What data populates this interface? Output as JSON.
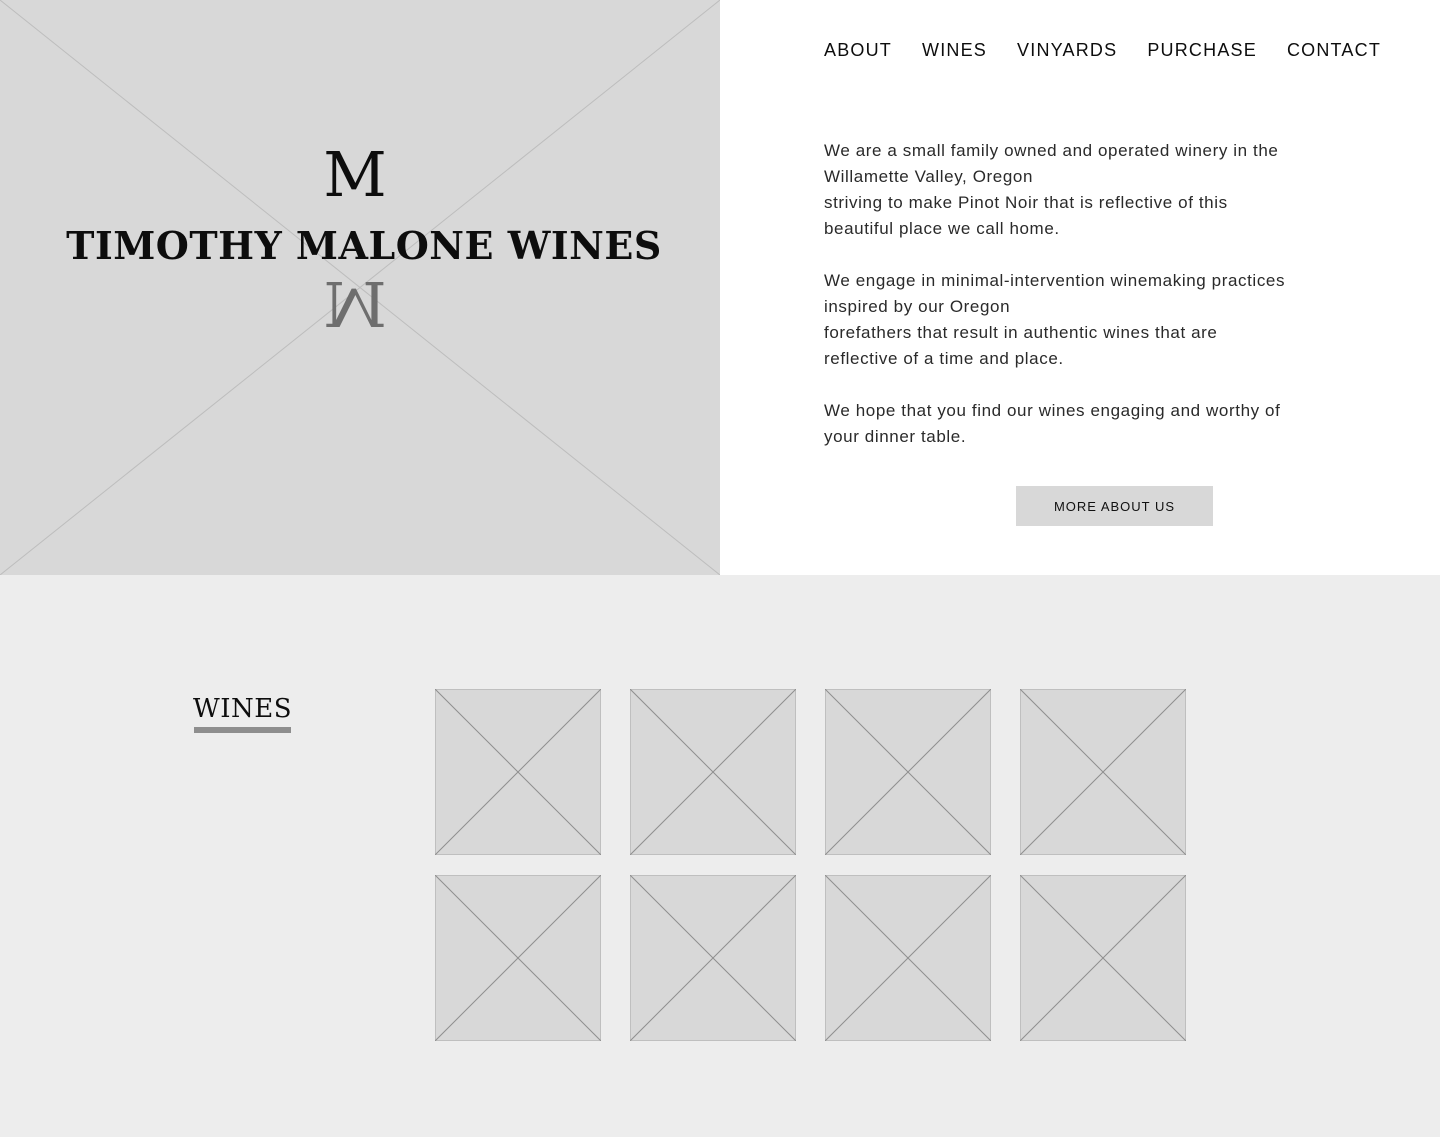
{
  "brand": {
    "monogram": "M",
    "name": "TIMOTHY MALONE WINES"
  },
  "nav": {
    "items": [
      "ABOUT",
      "WINES",
      "VINYARDS",
      "PURCHASE",
      "CONTACT"
    ]
  },
  "intro": {
    "paragraphs": [
      [
        "We are a small family owned and operated winery in the",
        "Willamette Valley, Oregon",
        "striving to make Pinot Noir that is reflective of this",
        "beautiful place we call home."
      ],
      [
        "We engage in minimal-intervention winemaking practices",
        "inspired by our Oregon",
        "forefathers that result in authentic wines that are",
        "reflective of a time and place."
      ],
      [
        "We hope that you find our wines engaging and worthy of",
        "your dinner table."
      ]
    ],
    "button_label": "MORE ABOUT US"
  },
  "wines": {
    "heading": "WINES",
    "tile_count": 8
  },
  "colors": {
    "placeholder": "#d8d8d8",
    "section_bg": "#ededed",
    "underline": "#8e8e8e"
  }
}
